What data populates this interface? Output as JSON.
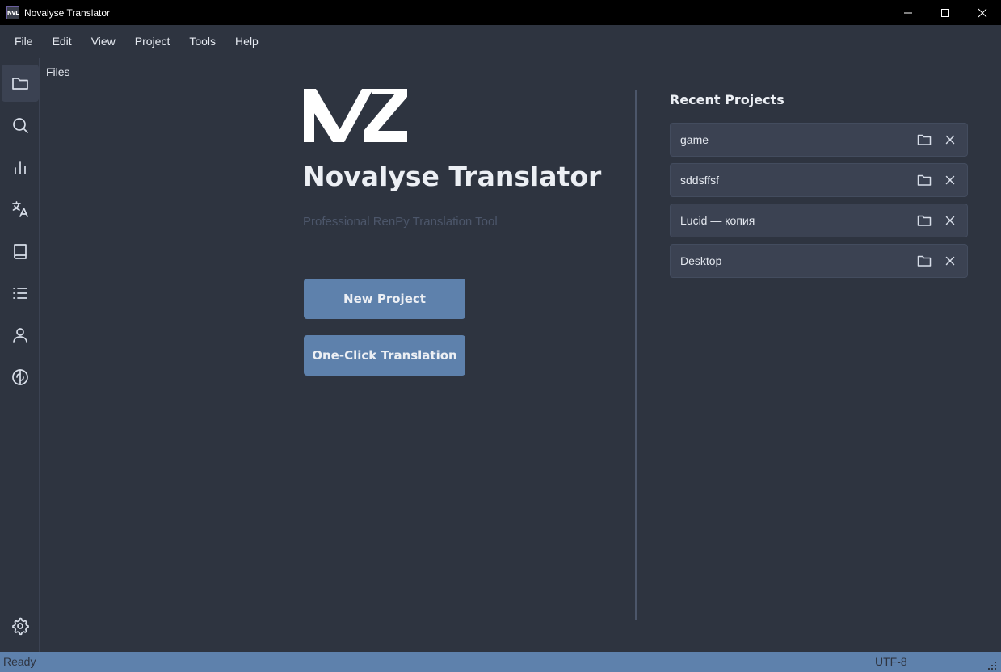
{
  "window": {
    "title": "Novalyse Translator",
    "icon_text": "NVL"
  },
  "menu": [
    "File",
    "Edit",
    "View",
    "Project",
    "Tools",
    "Help"
  ],
  "activity_bar": {
    "items": [
      {
        "icon": "folder-icon",
        "active": true
      },
      {
        "icon": "search-icon",
        "active": false
      },
      {
        "icon": "bar-chart-icon",
        "active": false
      },
      {
        "icon": "translate-icon",
        "active": false
      },
      {
        "icon": "book-icon",
        "active": false
      },
      {
        "icon": "list-icon",
        "active": false
      },
      {
        "icon": "user-icon",
        "active": false
      },
      {
        "icon": "brain-icon",
        "active": false
      }
    ],
    "bottom_icon": "gear-icon"
  },
  "files_panel": {
    "title": "Files"
  },
  "welcome": {
    "app_name": "Novalyse Translator",
    "tagline": "Professional RenPy Translation Tool",
    "new_project_label": "New Project",
    "one_click_label": "One-Click Translation"
  },
  "recent": {
    "title": "Recent Projects",
    "items": [
      {
        "name": "game"
      },
      {
        "name": "sddsffsf"
      },
      {
        "name": "Lucid — копия"
      },
      {
        "name": "Desktop"
      }
    ]
  },
  "status": {
    "left": "Ready",
    "encoding": "UTF-8"
  },
  "colors": {
    "background": "#2e3440",
    "accent": "#5e81ac",
    "card": "#3b4252"
  }
}
